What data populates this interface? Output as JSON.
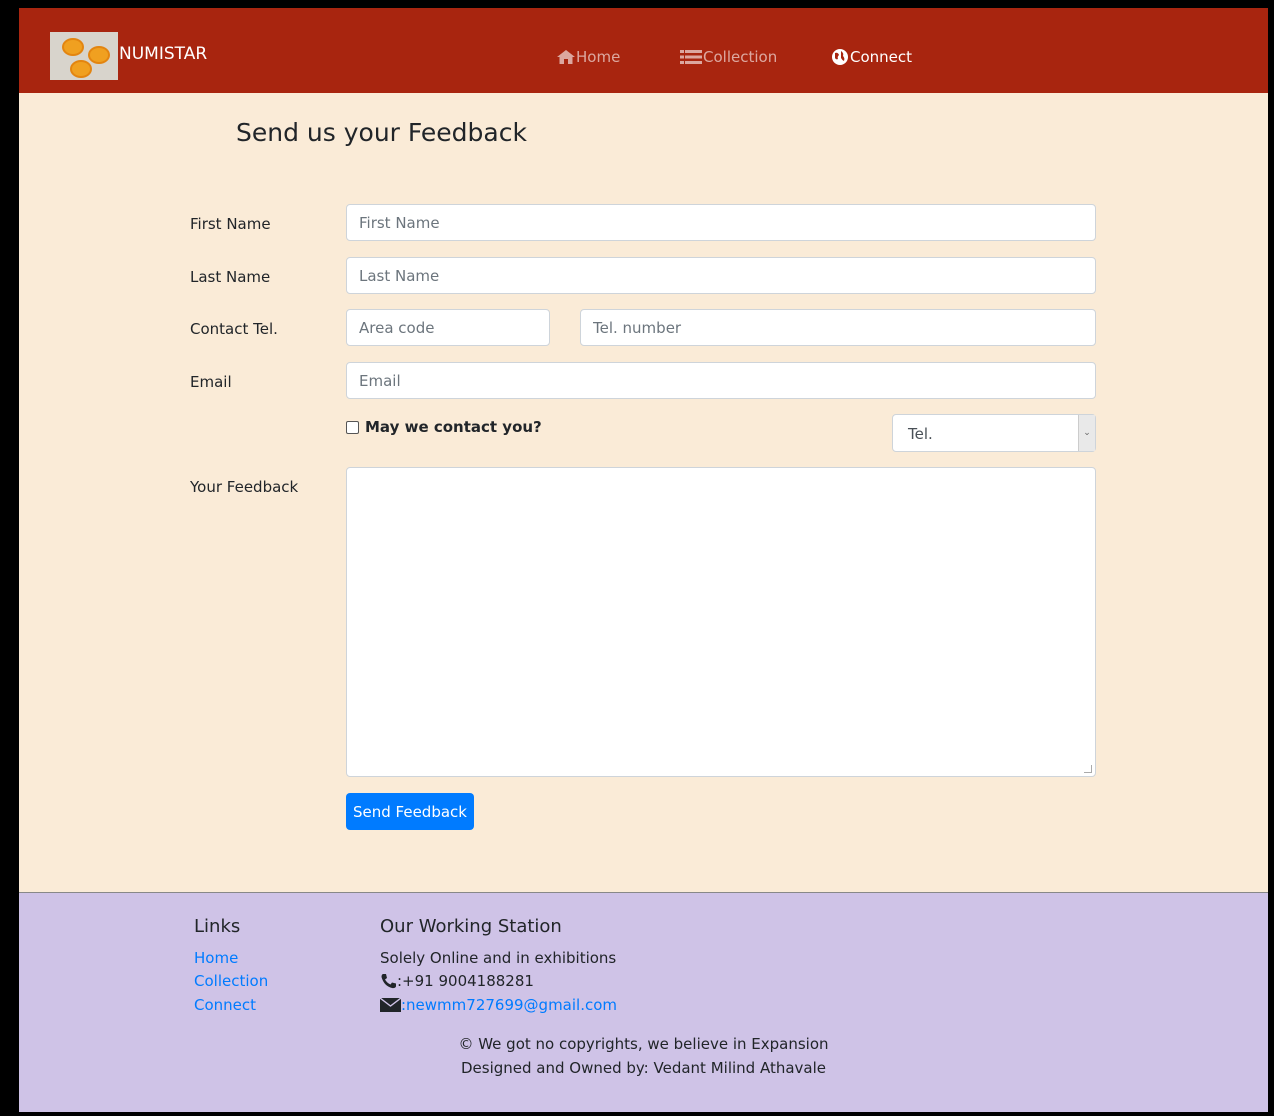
{
  "brand": {
    "name": "NUMISTAR"
  },
  "nav": [
    {
      "label": "Home",
      "icon": "home-icon"
    },
    {
      "label": "Collection",
      "icon": "list-icon"
    },
    {
      "label": "Connect",
      "icon": "globe-icon",
      "active": true
    }
  ],
  "page": {
    "title": "Send us your Feedback"
  },
  "form": {
    "first_name_label": "First Name",
    "first_name_placeholder": "First Name",
    "last_name_label": "Last Name",
    "last_name_placeholder": "Last Name",
    "contact_label": "Contact Tel.",
    "area_code_placeholder": "Area code",
    "tel_number_placeholder": "Tel. number",
    "email_label": "Email",
    "email_placeholder": "Email",
    "contact_check_label": "May we contact you?",
    "contact_method_selected": "Tel.",
    "feedback_label": "Your Feedback",
    "submit_label": "Send Feedback"
  },
  "footer": {
    "links_heading": "Links",
    "links": [
      "Home",
      "Collection",
      "Connect"
    ],
    "station_heading": "Our Working Station",
    "station_text": "Solely Online and in exhibitions",
    "phone": ":+91 9004188281",
    "email": ":newmm727699@gmail.com",
    "copyright": "© We got no copyrights, we believe in Expansion",
    "designed_by": "Designed and Owned by: Vedant Milind Athavale"
  },
  "colors": {
    "navbar": "#a8250f",
    "page_bg": "#faebd7",
    "footer_bg": "#cfc3e7",
    "primary": "#007bff"
  }
}
